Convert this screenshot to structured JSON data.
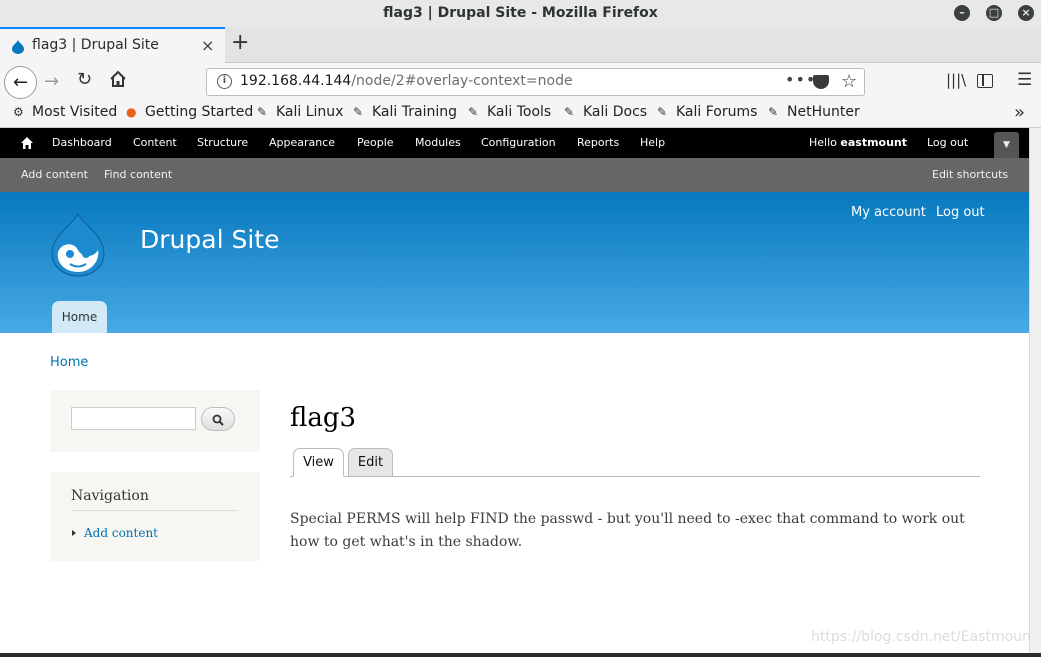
{
  "window": {
    "title": "flag3 | Drupal Site - Mozilla Firefox"
  },
  "tab": {
    "label": "flag3 | Drupal Site",
    "close": "×",
    "new_tab": "+"
  },
  "navbar": {
    "url_host": "192.168.44.144",
    "url_path": "/node/2#overlay-context=node",
    "page_actions": "•••"
  },
  "bookmarks": [
    {
      "label": "Most Visited",
      "icon": "gear-icon"
    },
    {
      "label": "Getting Started",
      "icon": "firefox-icon"
    },
    {
      "label": "Kali Linux",
      "icon": "kali-icon"
    },
    {
      "label": "Kali Training",
      "icon": "kali-icon"
    },
    {
      "label": "Kali Tools",
      "icon": "kali-icon"
    },
    {
      "label": "Kali Docs",
      "icon": "kali-icon"
    },
    {
      "label": "Kali Forums",
      "icon": "kali-icon"
    },
    {
      "label": "NetHunter",
      "icon": "kali-icon"
    }
  ],
  "toolbar": {
    "items": [
      "Dashboard",
      "Content",
      "Structure",
      "Appearance",
      "People",
      "Modules",
      "Configuration",
      "Reports",
      "Help"
    ],
    "hello": "Hello",
    "username": "eastmount",
    "logout": "Log out"
  },
  "shortcuts": {
    "add_content": "Add content",
    "find_content": "Find content",
    "edit_shortcuts": "Edit shortcuts"
  },
  "header": {
    "site_name": "Drupal Site",
    "my_account": "My account",
    "log_out": "Log out",
    "main_tab": "Home"
  },
  "breadcrumb": "Home",
  "sidebar": {
    "navigation_title": "Navigation",
    "navigation_link": "Add content"
  },
  "node": {
    "title": "flag3",
    "tab_view": "View",
    "tab_edit": "Edit",
    "body": "Special PERMS will help FIND the passwd - but you'll need to -exec that command to work out how to get what's in the shadow."
  },
  "watermark": "https://blog.csdn.net/Eastmount",
  "colors": {
    "drupal_blue": "#0779bf",
    "link": "#0071b3",
    "firefox_accent": "#0a84ff"
  }
}
